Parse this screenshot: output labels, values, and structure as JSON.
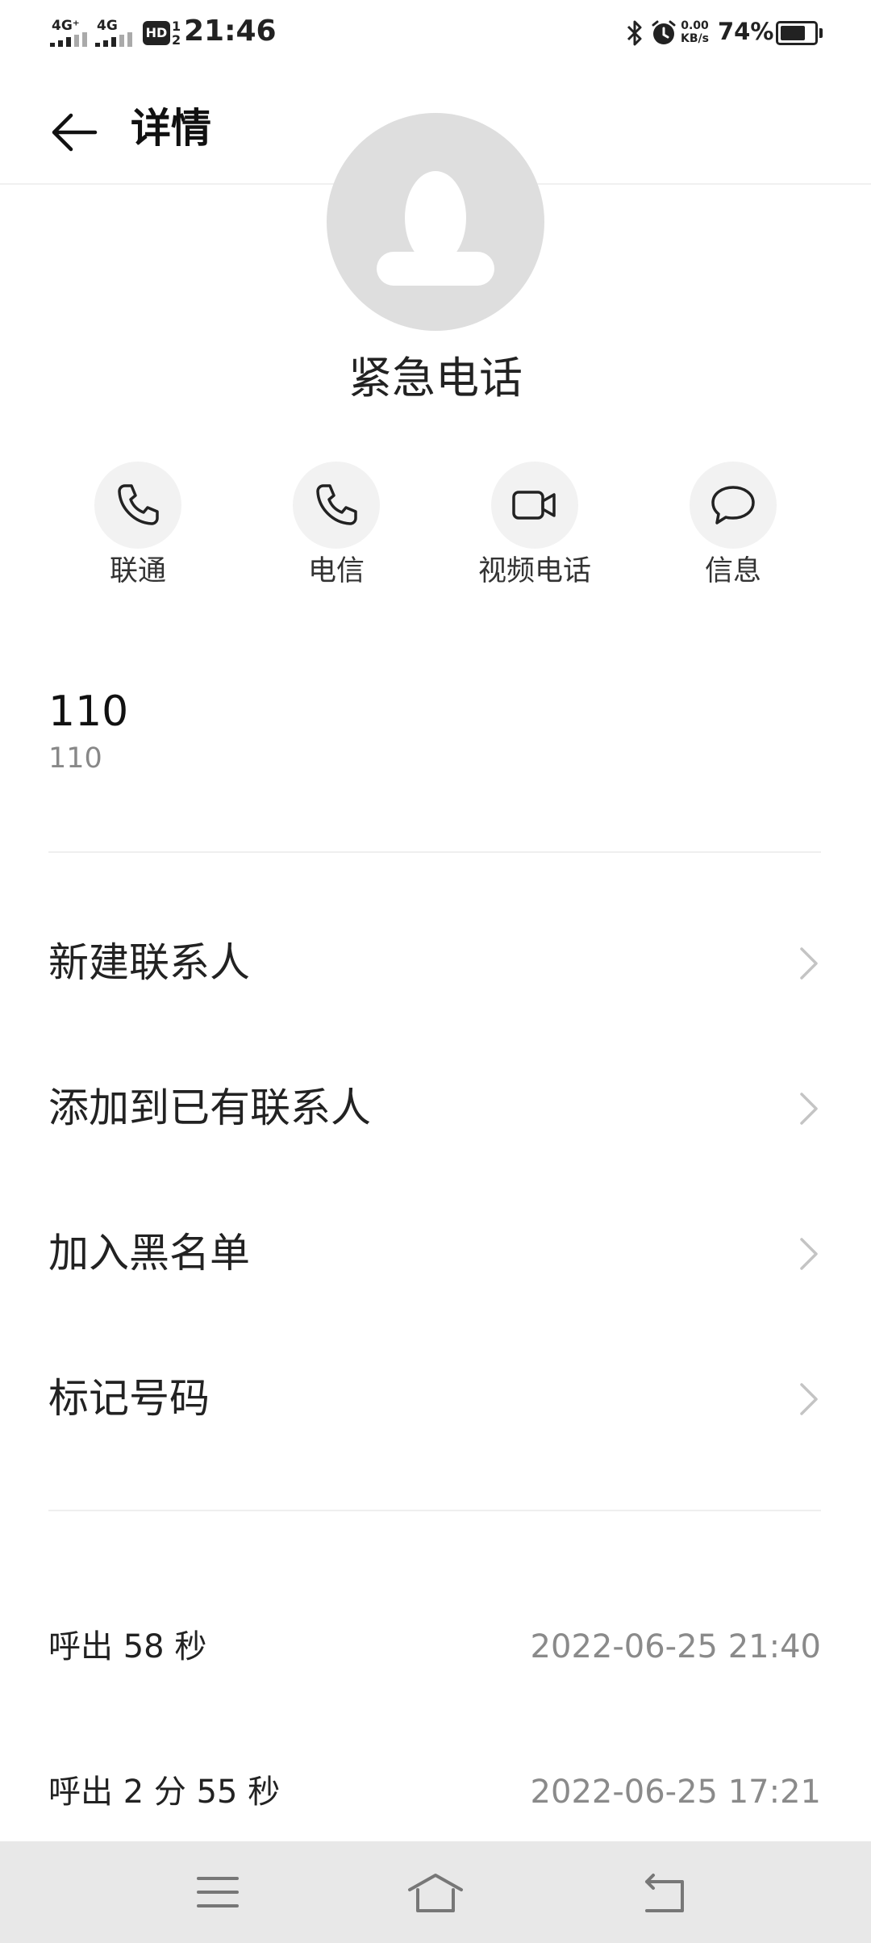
{
  "status_bar": {
    "sim1_label": "4G⁺",
    "sim2_label": "4G",
    "hd_label": "HD",
    "hd_sub": "1 2",
    "time": "21:46",
    "speed_value": "0.00",
    "speed_unit": "KB/s",
    "battery_percent": "74%",
    "battery_level": 0.74
  },
  "header": {
    "title": "详情"
  },
  "contact": {
    "name": "紧急电话",
    "number": "110",
    "number_sub": "110"
  },
  "actions": [
    {
      "label": "联通",
      "icon": "phone-icon"
    },
    {
      "label": "电信",
      "icon": "phone-icon"
    },
    {
      "label": "视频电话",
      "icon": "video-camera-icon"
    },
    {
      "label": "信息",
      "icon": "message-bubble-icon"
    }
  ],
  "menu": [
    {
      "label": "新建联系人"
    },
    {
      "label": "添加到已有联系人"
    },
    {
      "label": "加入黑名单"
    },
    {
      "label": "标记号码"
    }
  ],
  "call_log": [
    {
      "type": "呼出 58 秒",
      "time": "2022-06-25 21:40"
    },
    {
      "type": "呼出 2 分 55 秒",
      "time": "2022-06-25 17:21"
    }
  ],
  "colors": {
    "background": "#ffffff",
    "avatar_bg": "#dedede",
    "action_bg": "#f2f2f2",
    "secondary_text": "#8a8a8a",
    "nav_bar_bg": "#e8e8e8"
  }
}
